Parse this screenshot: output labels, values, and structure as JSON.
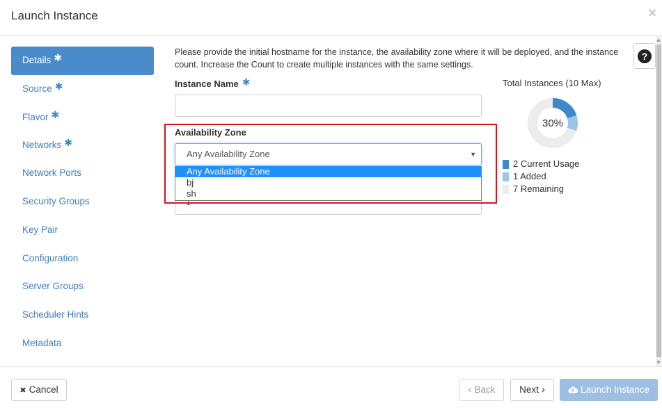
{
  "modal": {
    "title": "Launch Instance",
    "close_icon": "×"
  },
  "sidebar": {
    "items": [
      {
        "label": "Details",
        "required": true,
        "active": true
      },
      {
        "label": "Source",
        "required": true
      },
      {
        "label": "Flavor",
        "required": true
      },
      {
        "label": "Networks",
        "required": true
      },
      {
        "label": "Network Ports",
        "required": false
      },
      {
        "label": "Security Groups",
        "required": false
      },
      {
        "label": "Key Pair",
        "required": false
      },
      {
        "label": "Configuration",
        "required": false
      },
      {
        "label": "Server Groups",
        "required": false
      },
      {
        "label": "Scheduler Hints",
        "required": false
      },
      {
        "label": "Metadata",
        "required": false
      }
    ],
    "required_mark": "✱"
  },
  "help": {
    "icon": "question-circle-icon",
    "glyph": "?"
  },
  "form": {
    "description": "Please provide the initial hostname for the instance, the availability zone where it will be deployed, and the instance count. Increase the Count to create multiple instances with the same settings.",
    "instance_name_label": "Instance Name",
    "instance_name_value": "",
    "availability_zone_label": "Availability Zone",
    "availability_zone_value": "Any Availability Zone",
    "availability_zone_options": [
      "Any Availability Zone",
      "bj",
      "sh"
    ],
    "count_partial_value": "1"
  },
  "quota": {
    "title": "Total Instances (10 Max)",
    "percent_label": "30%",
    "max": 10,
    "current_usage": 2,
    "added": 1,
    "remaining": 7,
    "legend": [
      {
        "label": "2 Current Usage",
        "color": "#3f88c9"
      },
      {
        "label": "1 Added",
        "color": "#9dc4e6"
      },
      {
        "label": "7 Remaining",
        "color": "#ececec"
      }
    ]
  },
  "footer": {
    "cancel_label": "Cancel",
    "cancel_icon": "✖",
    "back_label": "Back",
    "back_icon": "‹",
    "next_label": "Next",
    "next_icon": "›",
    "launch_label": "Launch Instance",
    "launch_icon": "cloud-upload-icon"
  },
  "colors": {
    "accent": "#4a8ccb",
    "link": "#3f7ebf",
    "highlight_border": "#d2161e"
  }
}
